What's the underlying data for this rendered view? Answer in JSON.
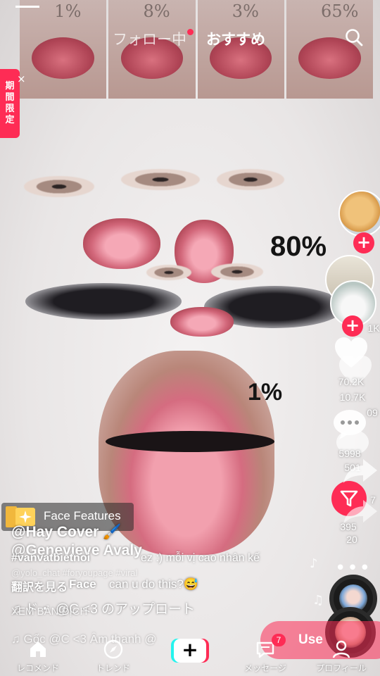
{
  "header": {
    "tab_following": "フォロー中",
    "tab_recommended": "おすすめ",
    "search_icon": "search-icon"
  },
  "promo": {
    "chars": [
      "期",
      "間",
      "限",
      "定"
    ],
    "close": "×"
  },
  "video": {
    "thumb_labels": [
      "1%",
      "8%",
      "3%",
      "65%"
    ],
    "pct_80": "80%",
    "pct_1": "1%"
  },
  "rail": {
    "likes": "70.2K",
    "likes_ghost": "10.7K",
    "likes_side": "1K",
    "comments": "5998",
    "comments_ghost": "501",
    "comments_side": "09",
    "shares": "395",
    "shares_ghost": "20",
    "shares_side": "7"
  },
  "effect": {
    "name": "Face Features"
  },
  "caption": {
    "username": "@Hay Cover 🖌️",
    "username_ghost": "@Genevieve Avaly",
    "hashtag": "#vanvatbietnoi",
    "caption_tail": "ez :) mỗi vị cao nhân kế",
    "ghost_tags": "@yolo_chat  #foryoupage  #viral",
    "translate": "翻訳を見る",
    "face_tag": "Face",
    "caption2": "can u do this?😅",
    "xem": "XEM BẢN DỊCH",
    "music": "♫  ド・ @C <3 のアップロート",
    "music_ghost": "♫  Gốc  @C <3 Âm thanh  @"
  },
  "use_button": {
    "label": "Use"
  },
  "nav": {
    "home": "レコメンド",
    "trends": "トレンド",
    "create": "+",
    "messages": "メッセージ",
    "messages_badge": "7",
    "profile": "プロフィール"
  },
  "colors": {
    "accent": "#fe2c55",
    "cyan": "#25f4ee"
  }
}
